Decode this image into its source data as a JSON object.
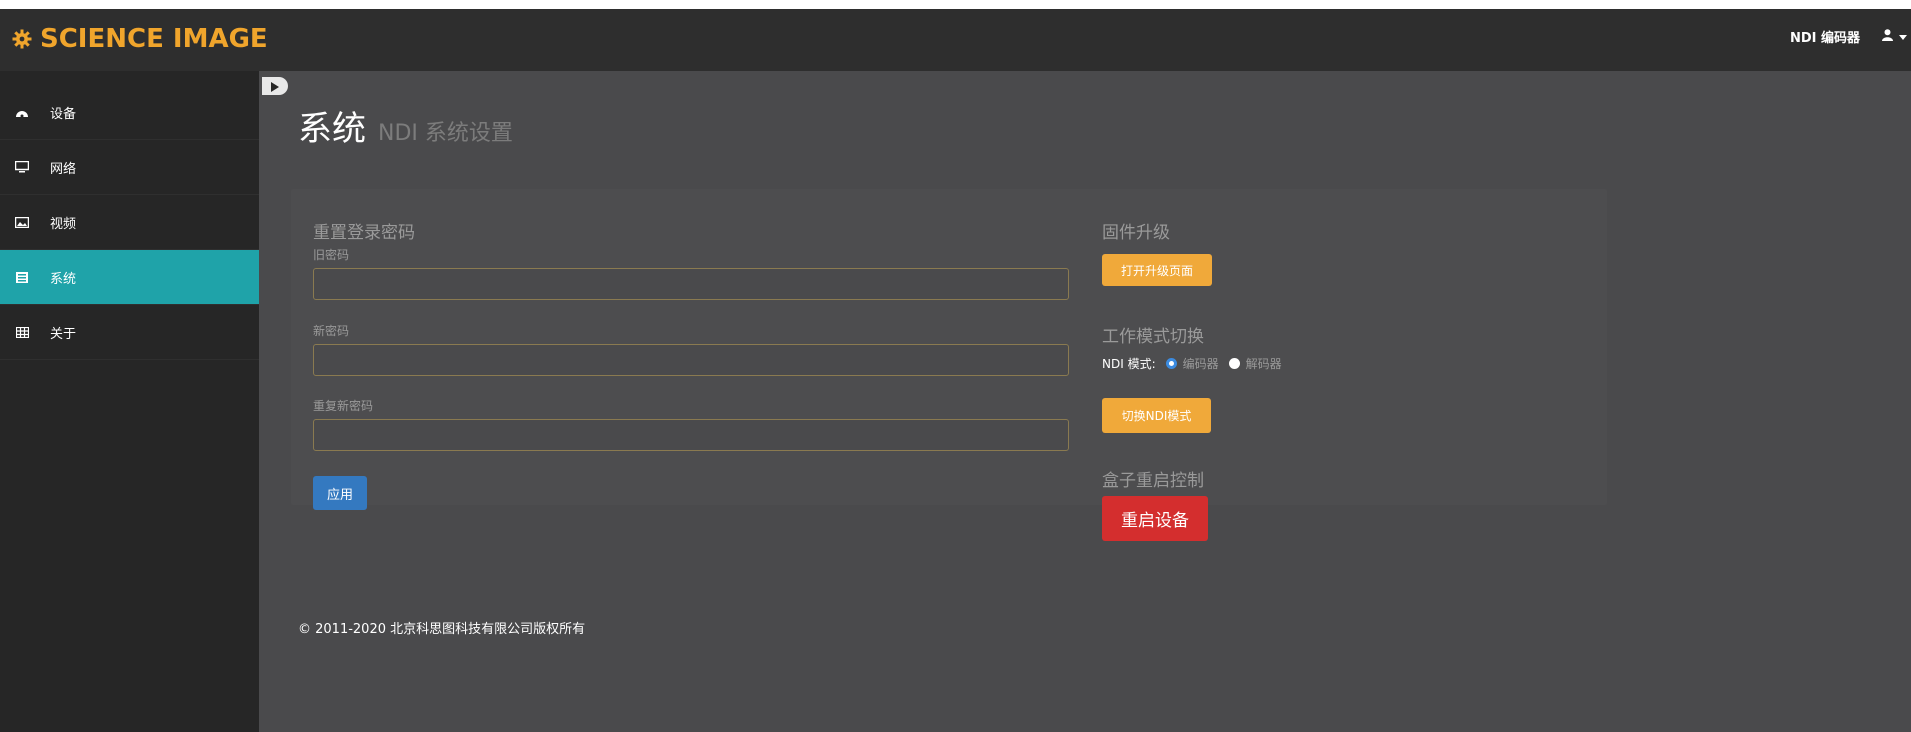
{
  "brand": {
    "title": "SCIENCE IMAGE",
    "icon": "gear-icon",
    "color": "#f0a52c"
  },
  "navbar": {
    "device_label": "NDI 编码器",
    "user_icon": "user-icon"
  },
  "sidebar": {
    "items": [
      {
        "label": "设备",
        "icon": "dashboard-icon"
      },
      {
        "label": "网络",
        "icon": "monitor-icon"
      },
      {
        "label": "视频",
        "icon": "picture-icon"
      },
      {
        "label": "系统",
        "icon": "system-icon",
        "active": true
      },
      {
        "label": "关于",
        "icon": "grid-icon"
      }
    ],
    "active_color": "#1fa3a9"
  },
  "page": {
    "title": "系统",
    "subtitle": "NDI 系统设置"
  },
  "password": {
    "section_title": "重置登录密码",
    "old_label": "旧密码",
    "old_value": "",
    "new_label": "新密码",
    "new_value": "",
    "repeat_label": "重复新密码",
    "repeat_value": "",
    "apply_button": "应用"
  },
  "firmware": {
    "section_title": "固件升级",
    "button": "打开升级页面"
  },
  "work_mode": {
    "section_title": "工作模式切换",
    "mode_label": "NDI 模式:",
    "options": [
      "编码器",
      "解码器"
    ],
    "selected": "编码器",
    "button": "切换NDI模式"
  },
  "reboot": {
    "section_title": "盒子重启控制",
    "button": "重启设备",
    "color": "#d42e2e"
  },
  "footer": {
    "copyright": "© 2011-2020 北京科思图科技有限公司版权所有"
  }
}
